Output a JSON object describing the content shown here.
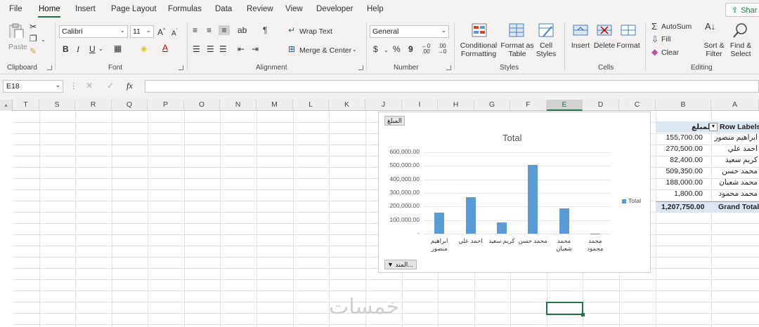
{
  "menu": {
    "tabs": [
      "File",
      "Home",
      "Insert",
      "Page Layout",
      "Formulas",
      "Data",
      "Review",
      "View",
      "Developer",
      "Help"
    ],
    "share": "Shar"
  },
  "ribbon": {
    "clipboard": {
      "paste": "Paste",
      "label": "Clipboard"
    },
    "font": {
      "name": "Calibri",
      "size": "11",
      "label": "Font",
      "bold": "B",
      "italic": "I",
      "underline": "U"
    },
    "alignment": {
      "wrap": "Wrap Text",
      "merge": "Merge & Center",
      "label": "Alignment"
    },
    "number": {
      "format": "General",
      "currency": "$",
      "percent": "%",
      "comma": "9",
      "inc": "←0 .00",
      "dec": ".00 →0",
      "label": "Number"
    },
    "styles": {
      "conditional": "Conditional",
      "conditional2": "Formatting",
      "formatas": "Format as",
      "formatas2": "Table",
      "cell": "Cell",
      "cell2": "Styles",
      "label": "Styles"
    },
    "cells": {
      "insert": "Insert",
      "delete": "Delete",
      "format": "Format",
      "label": "Cells"
    },
    "editing": {
      "autosum": "AutoSum",
      "fill": "Fill",
      "clear": "Clear",
      "sort": "Sort &",
      "sort2": "Filter",
      "find": "Find &",
      "find2": "Select",
      "label": "Editing"
    }
  },
  "formula_bar": {
    "name_box": "E18",
    "fx": "fx",
    "value": ""
  },
  "columns": [
    "T",
    "S",
    "R",
    "Q",
    "P",
    "O",
    "N",
    "M",
    "L",
    "K",
    "J",
    "I",
    "H",
    "G",
    "F",
    "E",
    "D",
    "C",
    "B",
    "A"
  ],
  "selected_column": "E",
  "pivot": {
    "header_value": "المبلغ",
    "header_labels": "Row Labels",
    "rows": [
      {
        "label": "ابراهيم منصور",
        "value": "155,700.00"
      },
      {
        "label": "احمد علي",
        "value": "270,500.00"
      },
      {
        "label": "كريم سعيد",
        "value": "82,400.00"
      },
      {
        "label": "محمد حسن",
        "value": "509,350.00"
      },
      {
        "label": "محمد شعبان",
        "value": "188,000.00"
      },
      {
        "label": "محمد محمود",
        "value": "1,800.00"
      }
    ],
    "grand_total_label": "Grand Total",
    "grand_total_value": "1,207,750.00"
  },
  "chart_data": {
    "type": "bar",
    "title": "Total",
    "value_field_button": "المبلغ",
    "axis_field_button": "المند...",
    "categories": [
      "ابراهيم منصور",
      "احمد علي",
      "كريم سعيد",
      "محمد حسن",
      "محمد شعبان",
      "محمد محمود"
    ],
    "series": [
      {
        "name": "Total",
        "values": [
          155700,
          270500,
          82400,
          509350,
          188000,
          1800
        ]
      }
    ],
    "ylim": [
      0,
      600000
    ],
    "yticks": [
      "600,000.00",
      "500,000.00",
      "400,000.00",
      "300,000.00",
      "200,000.00",
      "100,000.00",
      "-"
    ],
    "legend": "right",
    "color": "#5b9bd5"
  },
  "watermark": "خمسات"
}
